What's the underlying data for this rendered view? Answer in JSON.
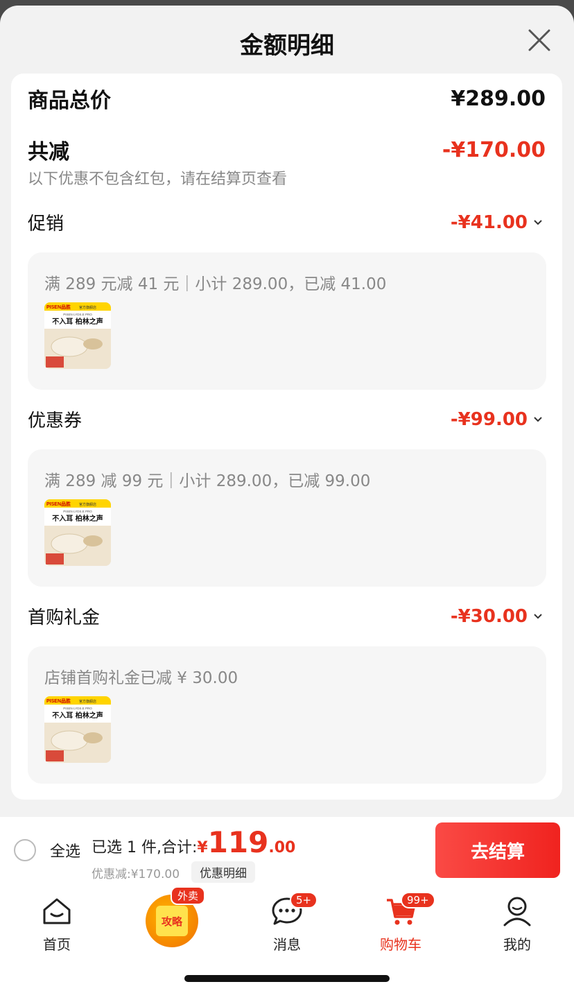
{
  "header": {
    "title": "金额明细"
  },
  "summary": {
    "total_label": "商品总价",
    "total_value": "¥289.00",
    "reduce_label": "共减",
    "reduce_value": "-¥170.00",
    "note": "以下优惠不包含红包，请在结算页查看"
  },
  "sections": [
    {
      "label": "促销",
      "value": "-¥41.00",
      "detail": "满 289 元减 41 元｜小计 289.00，已减 41.00"
    },
    {
      "label": "优惠券",
      "value": "-¥99.00",
      "detail": "满 289 减 99 元｜小计 289.00，已减 99.00"
    },
    {
      "label": "首购礼金",
      "value": "-¥30.00",
      "detail": "店铺首购礼金已减 ¥ 30.00"
    }
  ],
  "product_thumb": {
    "brand": "PISEN品胜",
    "tag": "官方旗舰店",
    "model": "PISEN LYDS.E PRO",
    "headline": "不入耳 柏林之声"
  },
  "checkout_bar": {
    "select_all": "全选",
    "selected_text": "已选 1 件,合计:",
    "currency": "¥",
    "total_int": "119",
    "total_dec": ".00",
    "discount_text": "优惠减:¥170.00",
    "detail_link": "优惠明细",
    "checkout_button": "去结算"
  },
  "tabbar": {
    "home": "首页",
    "promo_badge": "外卖",
    "promo_text": "攻略",
    "messages": "消息",
    "messages_badge": "5+",
    "cart": "购物车",
    "cart_badge": "99+",
    "me": "我的"
  },
  "colors": {
    "accent_red": "#e8321e",
    "background": "#f2f2f2"
  }
}
